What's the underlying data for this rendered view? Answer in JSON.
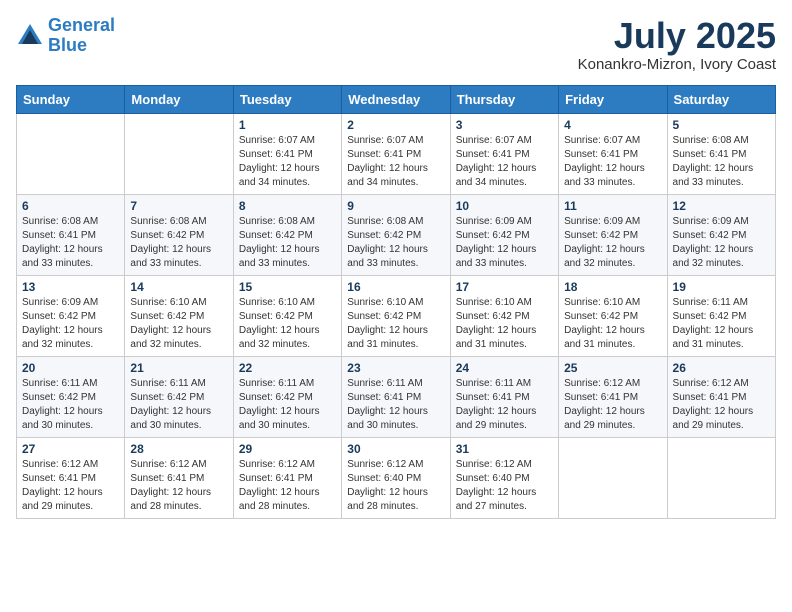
{
  "header": {
    "logo_line1": "General",
    "logo_line2": "Blue",
    "month": "July 2025",
    "location": "Konankro-Mizron, Ivory Coast"
  },
  "weekdays": [
    "Sunday",
    "Monday",
    "Tuesday",
    "Wednesday",
    "Thursday",
    "Friday",
    "Saturday"
  ],
  "weeks": [
    [
      {
        "day": "",
        "info": ""
      },
      {
        "day": "",
        "info": ""
      },
      {
        "day": "1",
        "info": "Sunrise: 6:07 AM\nSunset: 6:41 PM\nDaylight: 12 hours and 34 minutes."
      },
      {
        "day": "2",
        "info": "Sunrise: 6:07 AM\nSunset: 6:41 PM\nDaylight: 12 hours and 34 minutes."
      },
      {
        "day": "3",
        "info": "Sunrise: 6:07 AM\nSunset: 6:41 PM\nDaylight: 12 hours and 34 minutes."
      },
      {
        "day": "4",
        "info": "Sunrise: 6:07 AM\nSunset: 6:41 PM\nDaylight: 12 hours and 33 minutes."
      },
      {
        "day": "5",
        "info": "Sunrise: 6:08 AM\nSunset: 6:41 PM\nDaylight: 12 hours and 33 minutes."
      }
    ],
    [
      {
        "day": "6",
        "info": "Sunrise: 6:08 AM\nSunset: 6:41 PM\nDaylight: 12 hours and 33 minutes."
      },
      {
        "day": "7",
        "info": "Sunrise: 6:08 AM\nSunset: 6:42 PM\nDaylight: 12 hours and 33 minutes."
      },
      {
        "day": "8",
        "info": "Sunrise: 6:08 AM\nSunset: 6:42 PM\nDaylight: 12 hours and 33 minutes."
      },
      {
        "day": "9",
        "info": "Sunrise: 6:08 AM\nSunset: 6:42 PM\nDaylight: 12 hours and 33 minutes."
      },
      {
        "day": "10",
        "info": "Sunrise: 6:09 AM\nSunset: 6:42 PM\nDaylight: 12 hours and 33 minutes."
      },
      {
        "day": "11",
        "info": "Sunrise: 6:09 AM\nSunset: 6:42 PM\nDaylight: 12 hours and 32 minutes."
      },
      {
        "day": "12",
        "info": "Sunrise: 6:09 AM\nSunset: 6:42 PM\nDaylight: 12 hours and 32 minutes."
      }
    ],
    [
      {
        "day": "13",
        "info": "Sunrise: 6:09 AM\nSunset: 6:42 PM\nDaylight: 12 hours and 32 minutes."
      },
      {
        "day": "14",
        "info": "Sunrise: 6:10 AM\nSunset: 6:42 PM\nDaylight: 12 hours and 32 minutes."
      },
      {
        "day": "15",
        "info": "Sunrise: 6:10 AM\nSunset: 6:42 PM\nDaylight: 12 hours and 32 minutes."
      },
      {
        "day": "16",
        "info": "Sunrise: 6:10 AM\nSunset: 6:42 PM\nDaylight: 12 hours and 31 minutes."
      },
      {
        "day": "17",
        "info": "Sunrise: 6:10 AM\nSunset: 6:42 PM\nDaylight: 12 hours and 31 minutes."
      },
      {
        "day": "18",
        "info": "Sunrise: 6:10 AM\nSunset: 6:42 PM\nDaylight: 12 hours and 31 minutes."
      },
      {
        "day": "19",
        "info": "Sunrise: 6:11 AM\nSunset: 6:42 PM\nDaylight: 12 hours and 31 minutes."
      }
    ],
    [
      {
        "day": "20",
        "info": "Sunrise: 6:11 AM\nSunset: 6:42 PM\nDaylight: 12 hours and 30 minutes."
      },
      {
        "day": "21",
        "info": "Sunrise: 6:11 AM\nSunset: 6:42 PM\nDaylight: 12 hours and 30 minutes."
      },
      {
        "day": "22",
        "info": "Sunrise: 6:11 AM\nSunset: 6:42 PM\nDaylight: 12 hours and 30 minutes."
      },
      {
        "day": "23",
        "info": "Sunrise: 6:11 AM\nSunset: 6:41 PM\nDaylight: 12 hours and 30 minutes."
      },
      {
        "day": "24",
        "info": "Sunrise: 6:11 AM\nSunset: 6:41 PM\nDaylight: 12 hours and 29 minutes."
      },
      {
        "day": "25",
        "info": "Sunrise: 6:12 AM\nSunset: 6:41 PM\nDaylight: 12 hours and 29 minutes."
      },
      {
        "day": "26",
        "info": "Sunrise: 6:12 AM\nSunset: 6:41 PM\nDaylight: 12 hours and 29 minutes."
      }
    ],
    [
      {
        "day": "27",
        "info": "Sunrise: 6:12 AM\nSunset: 6:41 PM\nDaylight: 12 hours and 29 minutes."
      },
      {
        "day": "28",
        "info": "Sunrise: 6:12 AM\nSunset: 6:41 PM\nDaylight: 12 hours and 28 minutes."
      },
      {
        "day": "29",
        "info": "Sunrise: 6:12 AM\nSunset: 6:41 PM\nDaylight: 12 hours and 28 minutes."
      },
      {
        "day": "30",
        "info": "Sunrise: 6:12 AM\nSunset: 6:40 PM\nDaylight: 12 hours and 28 minutes."
      },
      {
        "day": "31",
        "info": "Sunrise: 6:12 AM\nSunset: 6:40 PM\nDaylight: 12 hours and 27 minutes."
      },
      {
        "day": "",
        "info": ""
      },
      {
        "day": "",
        "info": ""
      }
    ]
  ]
}
